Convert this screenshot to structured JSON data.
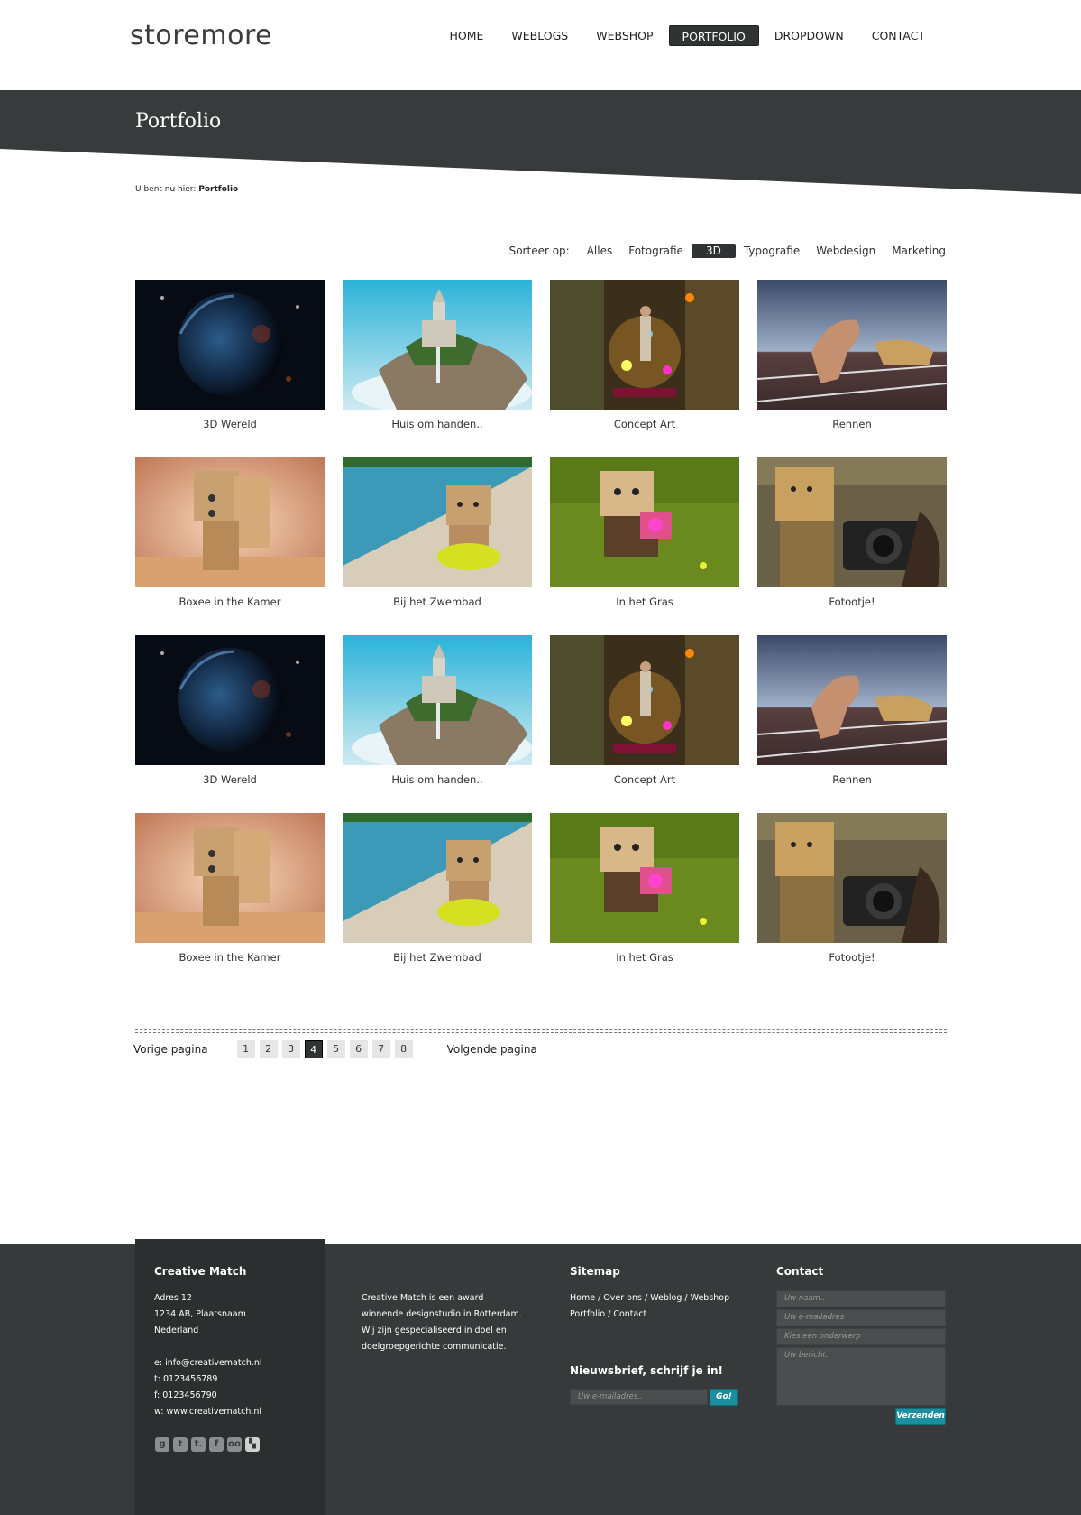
{
  "header": {
    "logo": "storemore",
    "nav": [
      {
        "label": "HOME",
        "active": false
      },
      {
        "label": "WEBLOGS",
        "active": false
      },
      {
        "label": "WEBSHOP",
        "active": false
      },
      {
        "label": "PORTFOLIO",
        "active": true
      },
      {
        "label": "DROPDOWN",
        "active": false
      },
      {
        "label": "CONTACT",
        "active": false
      }
    ]
  },
  "banner": {
    "title": "Portfolio"
  },
  "breadcrumb": {
    "prefix": "U bent nu hier:",
    "current": "Portfolio"
  },
  "filter": {
    "label": "Sorteer op:",
    "items": [
      "Alles",
      "Fotografie",
      "3D",
      "Typografie",
      "Webdesign",
      "Marketing"
    ],
    "active": "3D"
  },
  "portfolio": [
    {
      "caption": "3D Wereld",
      "image": "earth-3d"
    },
    {
      "caption": "Huis om handen..",
      "image": "castle-hand"
    },
    {
      "caption": "Concept Art",
      "image": "concept-art"
    },
    {
      "caption": "Rennen",
      "image": "runner-cheetah"
    },
    {
      "caption": "Boxee in the Kamer",
      "image": "boxee-room"
    },
    {
      "caption": "Bij het Zwembad",
      "image": "boxee-pool"
    },
    {
      "caption": "In het Gras",
      "image": "boxee-grass"
    },
    {
      "caption": "Fotootje!",
      "image": "boxee-camera"
    },
    {
      "caption": "3D Wereld",
      "image": "earth-3d"
    },
    {
      "caption": "Huis om handen..",
      "image": "castle-hand"
    },
    {
      "caption": "Concept Art",
      "image": "concept-art"
    },
    {
      "caption": "Rennen",
      "image": "runner-cheetah"
    },
    {
      "caption": "Boxee in the Kamer",
      "image": "boxee-room"
    },
    {
      "caption": "Bij het Zwembad",
      "image": "boxee-pool"
    },
    {
      "caption": "In het Gras",
      "image": "boxee-grass"
    },
    {
      "caption": "Fotootje!",
      "image": "boxee-camera"
    }
  ],
  "pagination": {
    "prev": "Vorige pagina",
    "next": "Volgende pagina",
    "pages": [
      "1",
      "2",
      "3",
      "4",
      "5",
      "6",
      "7",
      "8"
    ],
    "current": "4"
  },
  "footer": {
    "company": {
      "title": "Creative Match",
      "address": [
        "Adres 12",
        "1234 AB, Plaatsnaam",
        "Nederland"
      ],
      "email": "e: info@creativematch.nl",
      "phone": "t: 0123456789",
      "fax": "f: 0123456790",
      "web": "w: www.creativematch.nl",
      "social": [
        "g",
        "t",
        "t.",
        "f",
        "oo",
        "▚"
      ]
    },
    "about": [
      "Creative Match is een award",
      "winnende designstudio in Rotterdam.",
      "Wij zijn gespecialiseerd in doel en",
      "doelgroepgerichte communicatie."
    ],
    "sitemap": {
      "title": "Sitemap",
      "line1": "Home / Over ons / Weblog / Webshop",
      "line2": "Portfolio / Contact"
    },
    "newsletter": {
      "title": "Nieuwsbrief, schrijf je in!",
      "placeholder": "Uw e-mailadres..",
      "button": "Go!"
    },
    "contact": {
      "title": "Contact",
      "name_placeholder": "Uw naam..",
      "email_placeholder": "Uw e-mailadres",
      "subject_placeholder": "Kies een onderwerp",
      "message_placeholder": "Uw bericht..",
      "button": "Verzenden"
    }
  }
}
